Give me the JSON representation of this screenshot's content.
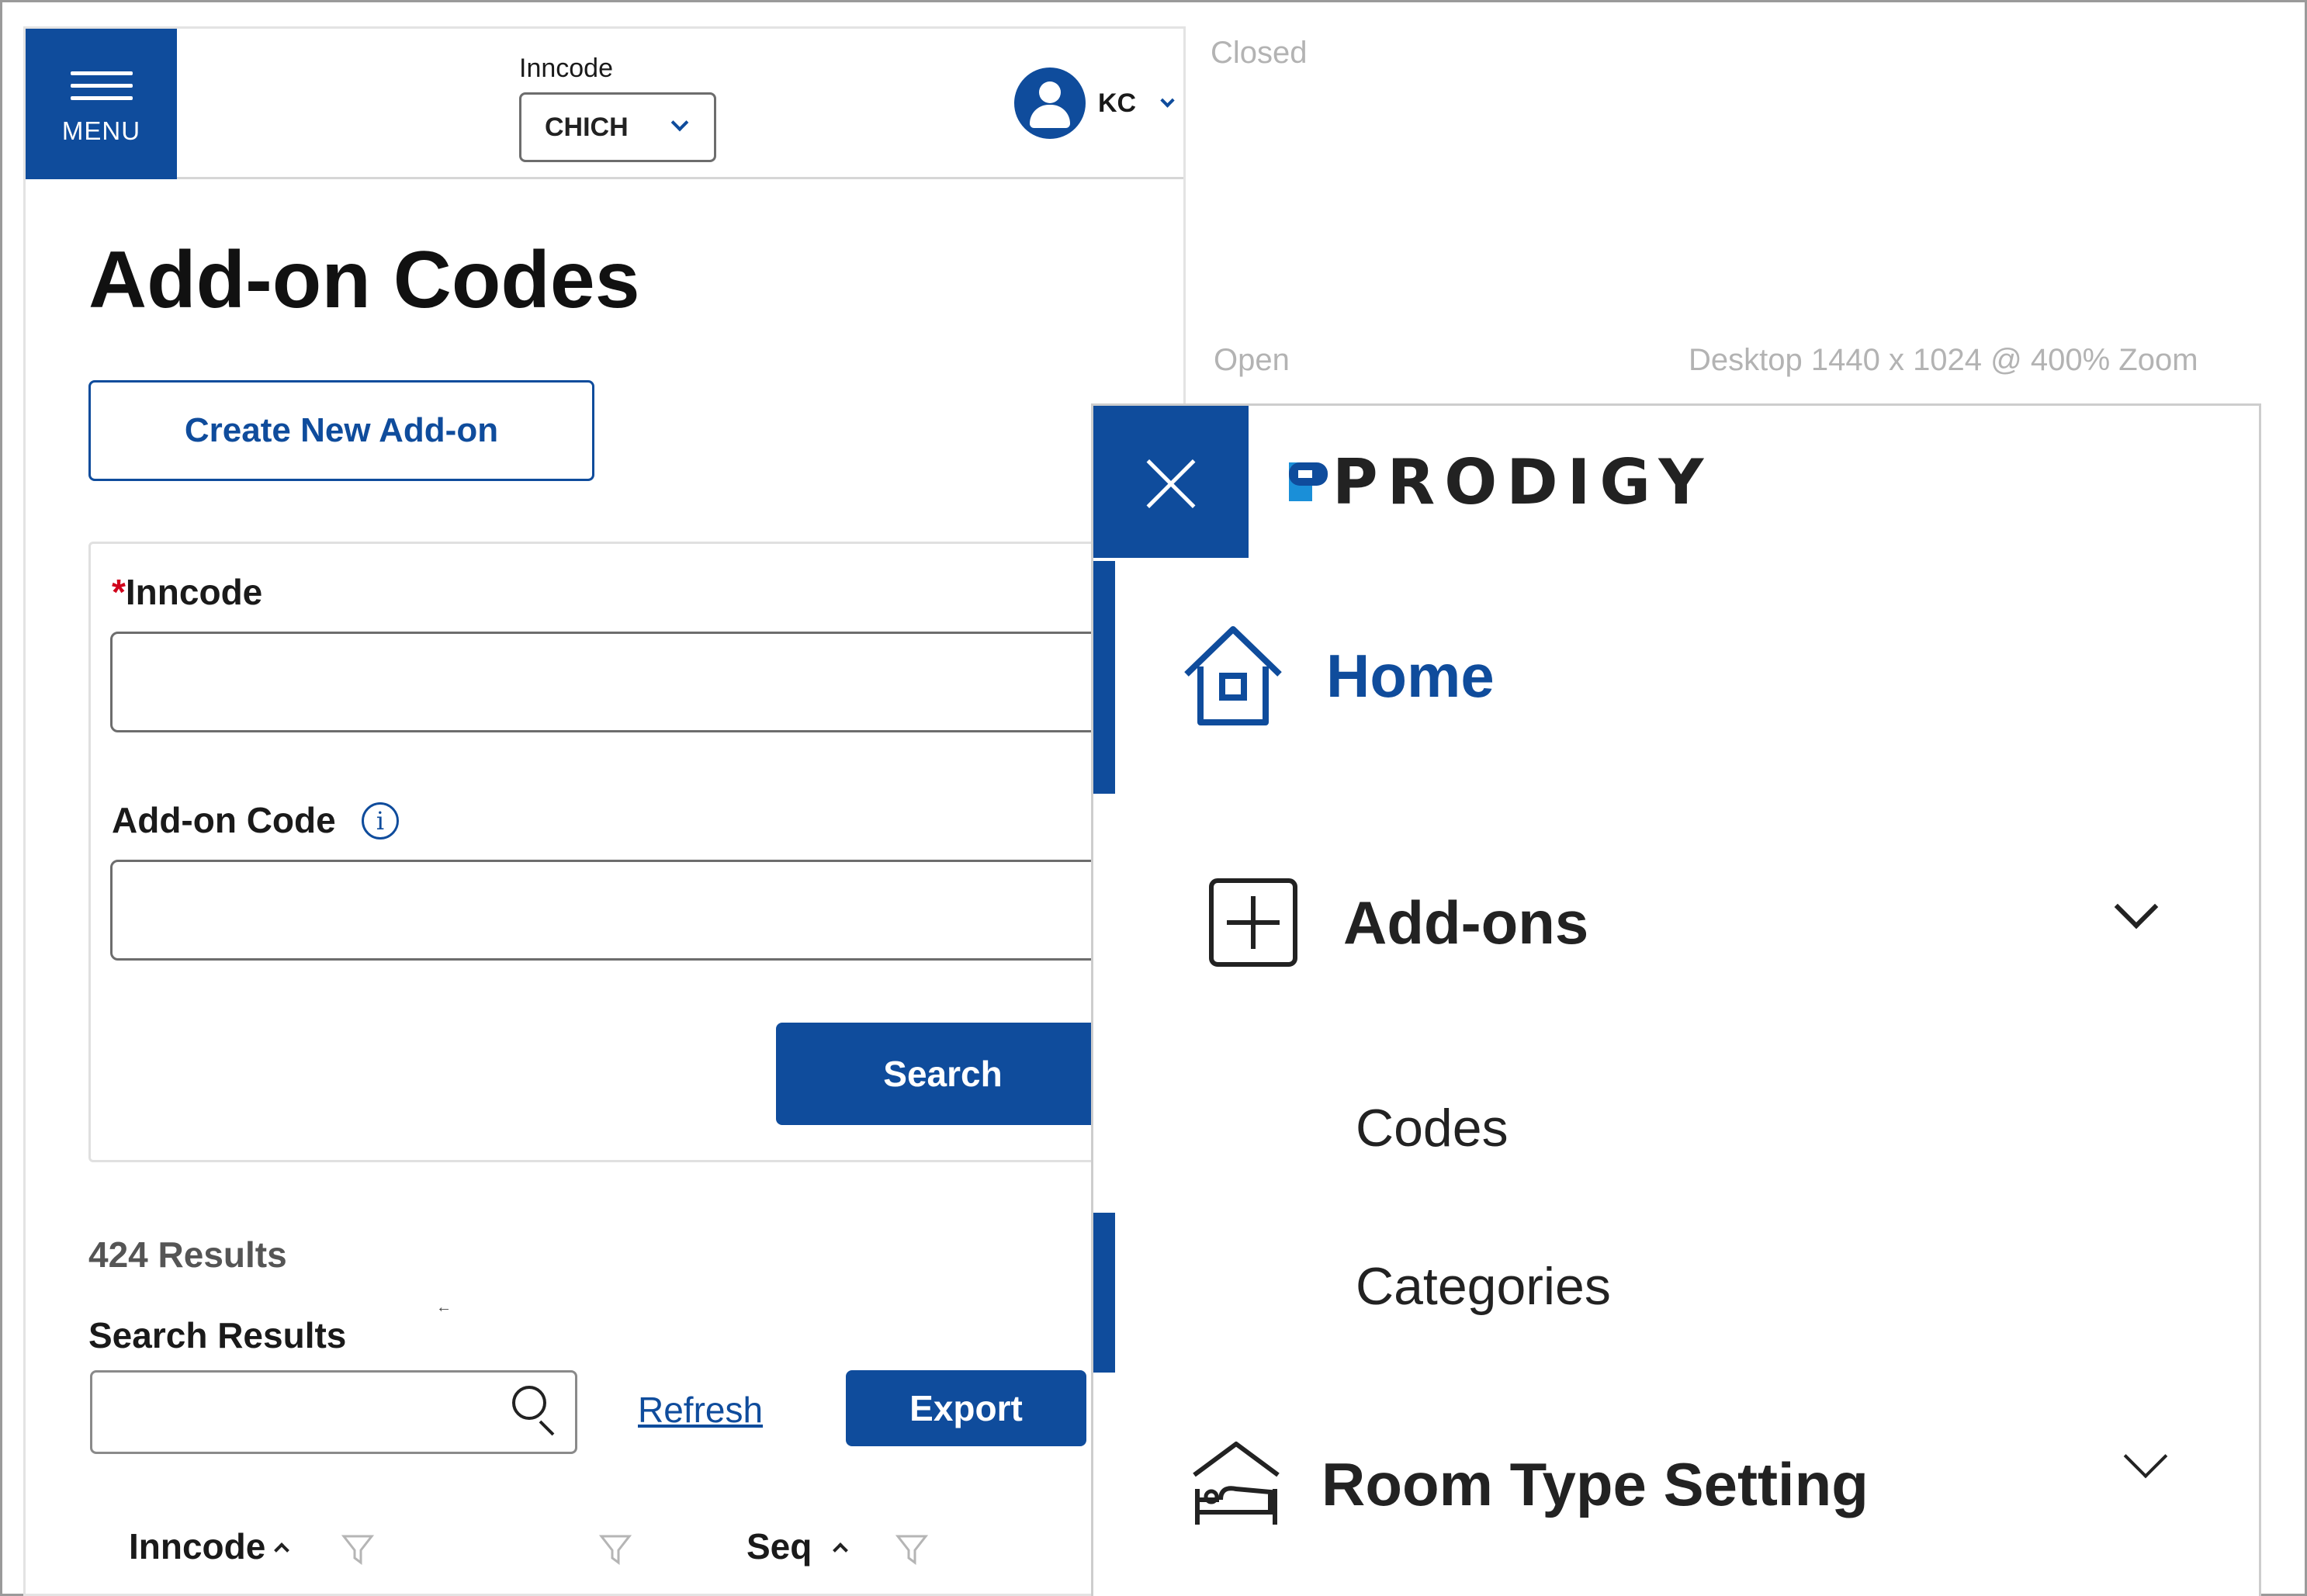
{
  "annotations": {
    "closed": "Closed",
    "open": "Open",
    "viewport": "Desktop 1440 x 1024 @ 400% Zoom"
  },
  "header": {
    "menu_label": "MENU",
    "inncode_label": "Inncode",
    "inncode_value": "CHICH",
    "user_initials": "KC"
  },
  "page": {
    "title": "Add-on Codes",
    "create_button": "Create New Add-on"
  },
  "search_form": {
    "required_marker": "*",
    "inncode_label": "Inncode",
    "inncode_value": "",
    "addon_code_label": "Add-on Code",
    "addon_code_value": "",
    "info_glyph": "i",
    "search_button": "Search"
  },
  "results": {
    "count_text": "424 Results",
    "title": "Search Results",
    "filter_value": "",
    "refresh_link": "Refresh",
    "export_button": "Export",
    "columns": [
      "Inncode",
      "Seq"
    ]
  },
  "menu_drawer": {
    "brand": "PRODIGY",
    "items": [
      {
        "label": "Home",
        "icon": "home-icon",
        "active": true
      },
      {
        "label": "Add-ons",
        "icon": "plus-square-icon",
        "expanded": true,
        "children": [
          "Codes",
          "Categories"
        ]
      },
      {
        "label": "Room Type Setting",
        "icon": "bed-house-icon",
        "expanded": false
      }
    ]
  },
  "colors": {
    "primary": "#0f4c9c",
    "required": "#d0021b",
    "annotation": "#b3b3b3"
  }
}
